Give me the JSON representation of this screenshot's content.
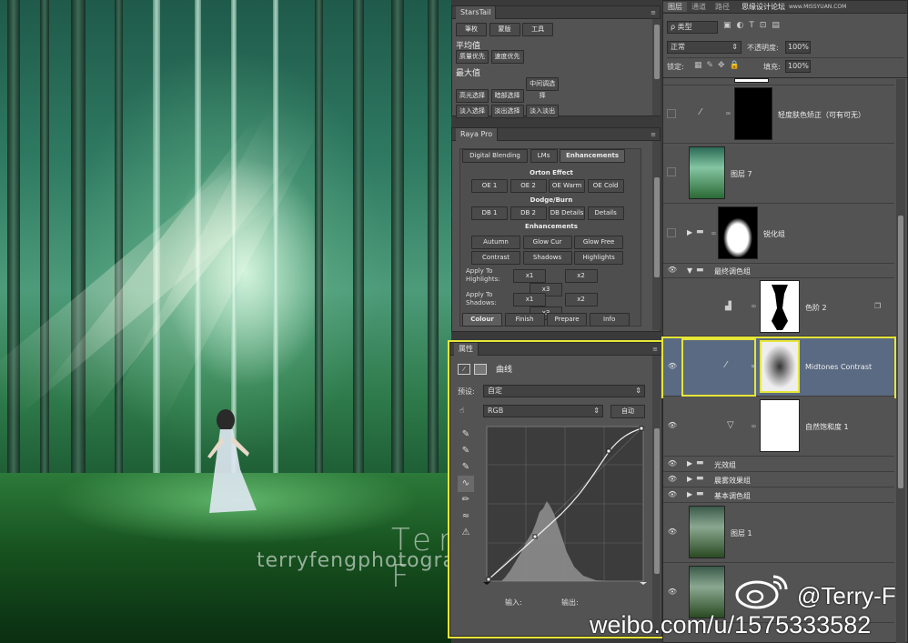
{
  "stars_tail": {
    "title": "StarsTail",
    "tabs": [
      "筆枚",
      "蒙版",
      "工具"
    ],
    "section_avg": "平均值",
    "avg_buttons": [
      "质量优先",
      "速度优先"
    ],
    "section_max": "最大值",
    "max_buttons": [
      "高光选择",
      "暗部选择",
      "中间调选择",
      "淡入选择",
      "淡出选择",
      "淡入淡出"
    ]
  },
  "raya_pro": {
    "title": "Raya Pro",
    "tabs": [
      "Digital Blending",
      "LMs",
      "Enhancements"
    ],
    "orton_title": "Orton Effect",
    "orton_buttons": [
      "OE 1",
      "OE 2",
      "OE Warm",
      "OE Cold"
    ],
    "dodge_title": "Dodge/Burn",
    "dodge_buttons": [
      "DB 1",
      "DB 2",
      "DB Details",
      "Details"
    ],
    "enh_title": "Enhancements",
    "enh_buttons": [
      "Autumn",
      "Glow Cur",
      "Glow Free",
      "Contrast",
      "Shadows",
      "Highlights"
    ],
    "apply_highlights": "Apply To Highlights:",
    "apply_shadows": "Apply To Shadows:",
    "x_buttons": [
      "x1",
      "x2",
      "x3"
    ],
    "bottom_tabs": [
      "Colour",
      "Finish",
      "Prepare",
      "Info"
    ]
  },
  "properties": {
    "title": "属性",
    "type_label": "曲线",
    "preset_label": "预设:",
    "preset_value": "自定",
    "channel_value": "RGB",
    "auto_button": "自动",
    "input_label": "输入:",
    "output_label": "输出:"
  },
  "layers_panel": {
    "tabs": [
      "图层",
      "通道",
      "路径"
    ],
    "kind_filter": "ρ 类型",
    "blend_mode": "正常",
    "opacity_label": "不透明度:",
    "opacity_value": "100%",
    "lock_label": "锁定:",
    "fill_label": "填充:",
    "fill_value": "100%",
    "layers": [
      {
        "name": "轻度肤色矫正（可有可无）"
      },
      {
        "name": "图层 7"
      },
      {
        "name": "锐化组"
      },
      {
        "name": "最终调色组"
      },
      {
        "name": "色阶 2"
      },
      {
        "name": "Midtones Contrast"
      },
      {
        "name": "自然饱和度 1"
      },
      {
        "name": "光效组"
      },
      {
        "name": "晨雾效果组"
      },
      {
        "name": "基本调色组"
      },
      {
        "name": "图层 1"
      }
    ]
  },
  "watermarks": {
    "site": "思缘设计论坛",
    "site_url": "www.MISSYUAN.COM",
    "photographer": "Terry F",
    "photographer_site": "terryfengphotography.lofter.com",
    "weibo_handle": "@Terry-F",
    "weibo_url": "weibo.com/u/1575333582"
  },
  "colors": {
    "highlight": "#e6e638",
    "selected_layer": "#5a6a82",
    "panel_bg": "#535353"
  }
}
